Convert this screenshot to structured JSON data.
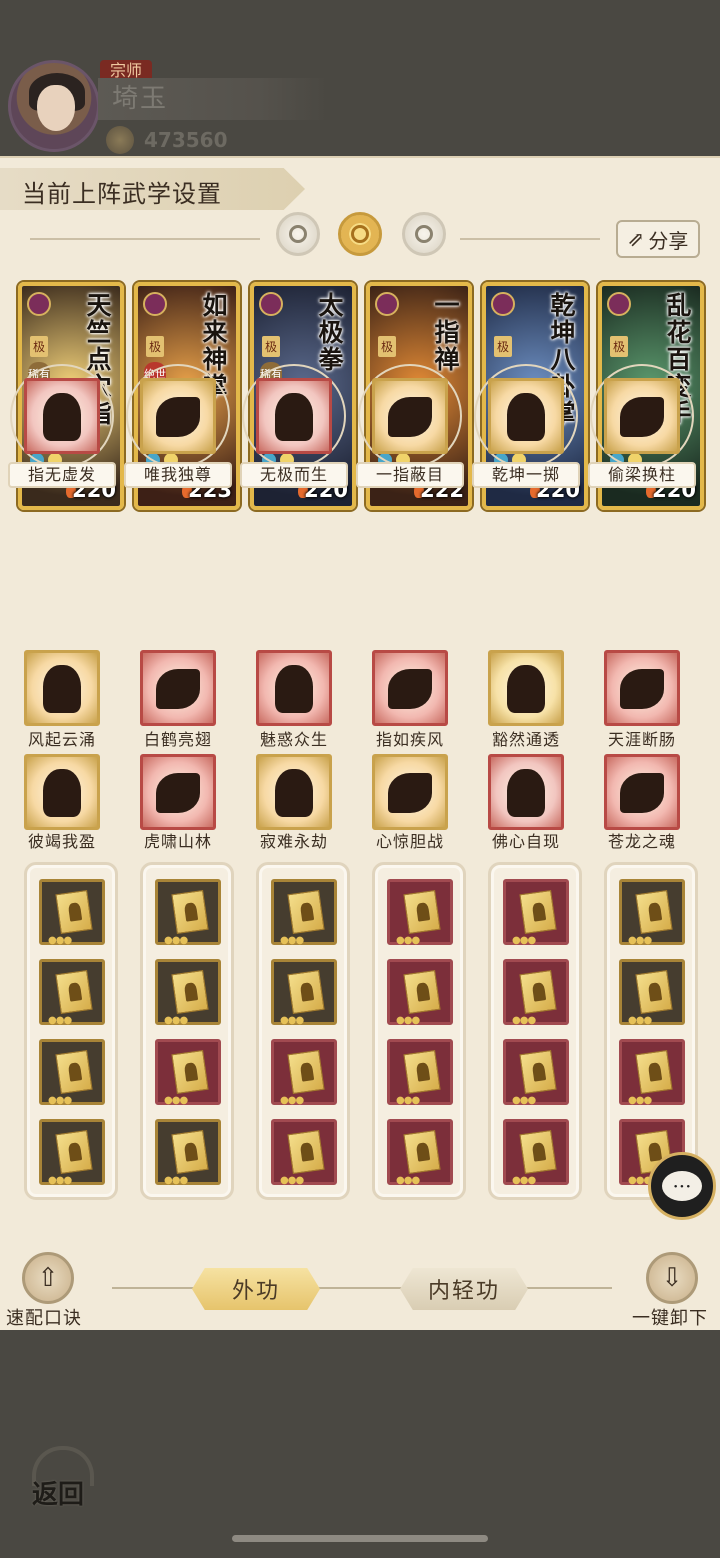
{
  "player": {
    "rank_badge": "宗师",
    "name": "埼玉",
    "power": "473560"
  },
  "panel": {
    "title": "当前上阵武学设置",
    "share_label": "分享",
    "mode_icons": [
      "crescent-moon-icon",
      "sun-icon",
      "ring-moon-icon"
    ],
    "active_mode_index": 1
  },
  "cards": [
    {
      "name": "天竺点穴指",
      "grade": "极",
      "rarity": "稀有",
      "power": "220",
      "colors": [
        "#f3d27a",
        "#3a2a1c"
      ]
    },
    {
      "name": "如来神掌",
      "grade": "极",
      "rarity": "绝世",
      "power": "223",
      "colors": [
        "#e9a24a",
        "#3d2016"
      ]
    },
    {
      "name": "太极拳",
      "grade": "极",
      "rarity": "稀有",
      "power": "220",
      "colors": [
        "#5b6a8d",
        "#1d2233"
      ]
    },
    {
      "name": "一指禅",
      "grade": "极",
      "rarity": "",
      "power": "222",
      "colors": [
        "#e38b36",
        "#3b2216"
      ]
    },
    {
      "name": "乾坤八卦掌",
      "grade": "极",
      "rarity": "",
      "power": "220",
      "colors": [
        "#6d8fc2",
        "#1f2a44"
      ]
    },
    {
      "name": "乱花百变手",
      "grade": "极",
      "rarity": "",
      "power": "220",
      "colors": [
        "#5c9a6e",
        "#1a2a20"
      ]
    }
  ],
  "skills_row1": [
    "指无虚发",
    "唯我独尊",
    "无极而生",
    "一指蔽目",
    "乾坤一掷",
    "偷梁换柱"
  ],
  "skills_row2": [
    "风起云涌",
    "白鹤亮翅",
    "魅惑众生",
    "指如疾风",
    "豁然通透",
    "天涯断肠"
  ],
  "skills_row3": [
    "彼竭我盈",
    "虎啸山林",
    "寂难永劫",
    "心惊胆战",
    "佛心自现",
    "苍龙之魂"
  ],
  "bottom": {
    "left_button": "速配口诀",
    "tab_outer": "外功",
    "tab_inner": "内轻功",
    "right_button": "一键卸下"
  },
  "back_label": "返回",
  "colors": {
    "panel_bg": "#f2ead9",
    "gold": "#e3b84a",
    "active_tab": "#f6e2a2"
  }
}
